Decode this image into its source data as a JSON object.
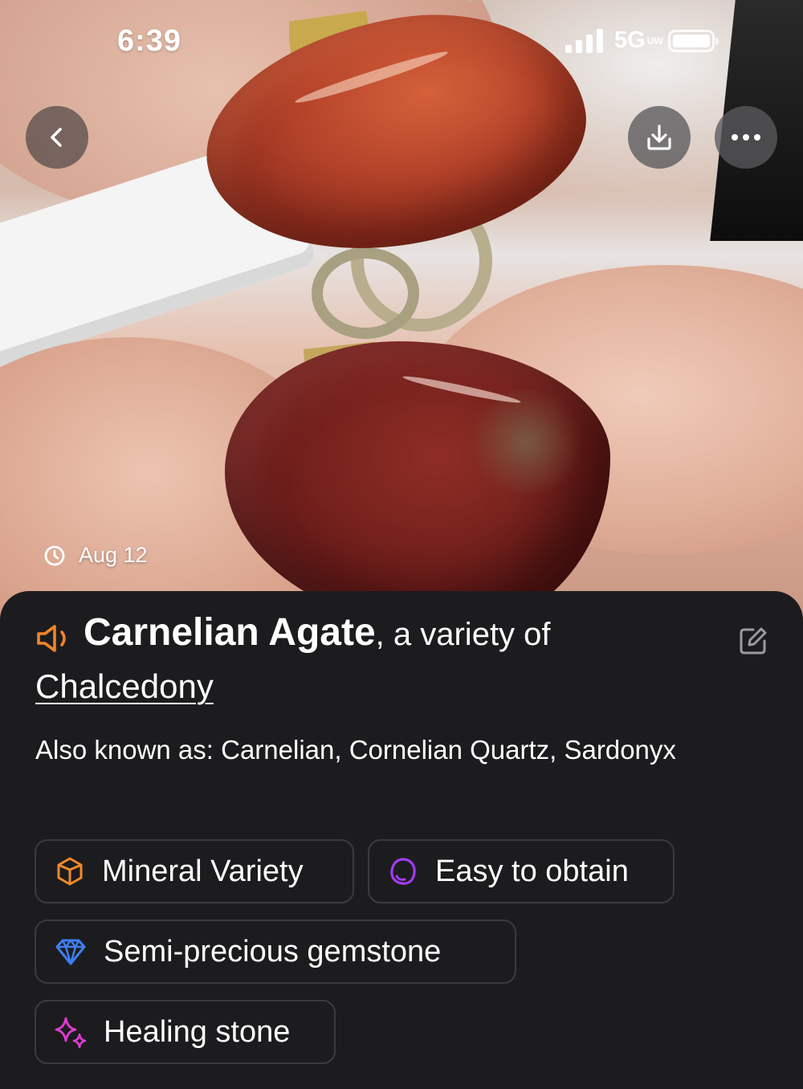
{
  "status_bar": {
    "time": "6:39",
    "network": "5G",
    "network_suffix": "UW"
  },
  "photo": {
    "date": "Aug 12"
  },
  "identification": {
    "name": "Carnelian Agate",
    "variety_text": ", a variety of",
    "parent_mineral": "Chalcedony",
    "aka_label": "Also known as:",
    "aka_values": "Carnelian, Cornelian Quartz, Sardonyx"
  },
  "tags": [
    {
      "label": "Mineral Variety",
      "icon": "crystal-icon",
      "color": "#f08a2c"
    },
    {
      "label": "Easy to obtain",
      "icon": "stone-icon",
      "color": "#a23bf0"
    },
    {
      "label": "Semi-precious gemstone",
      "icon": "diamond-icon",
      "color": "#3f7ef0"
    },
    {
      "label": "Healing stone",
      "icon": "sparkle-icon",
      "color": "#e03bd2"
    }
  ],
  "colors": {
    "speaker_accent": "#f0842c",
    "sheet_background": "#1c1c1e"
  }
}
